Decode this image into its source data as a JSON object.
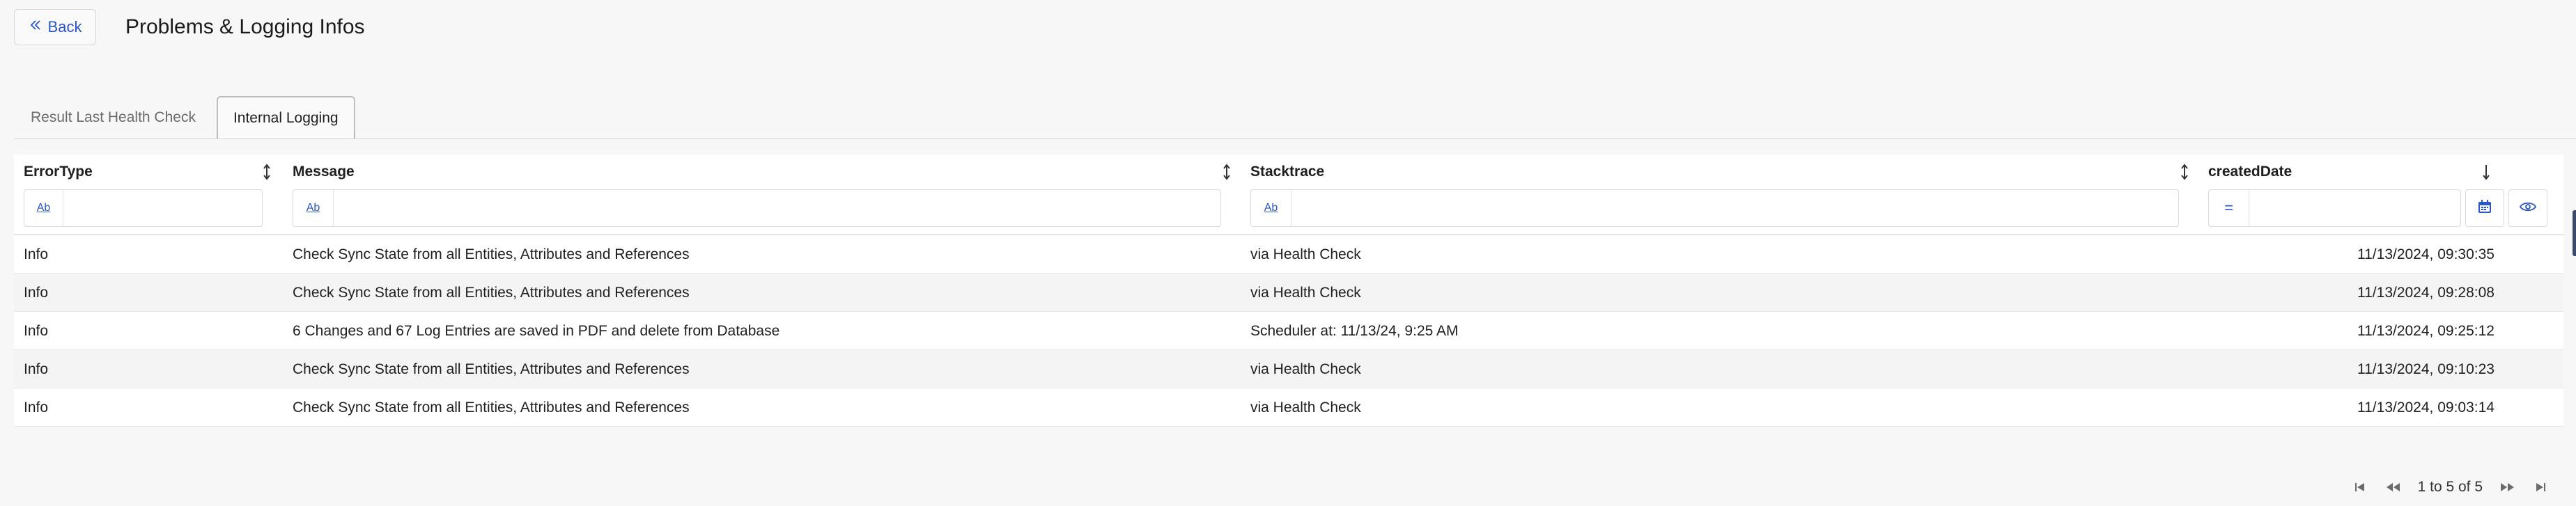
{
  "header": {
    "back_label": "Back",
    "title": "Problems & Logging Infos"
  },
  "tabs": [
    {
      "label": "Result Last Health Check",
      "active": false
    },
    {
      "label": "Internal Logging",
      "active": true
    }
  ],
  "table": {
    "columns": [
      {
        "label": "ErrorType",
        "sort": "unsorted",
        "filter_type": "Ab"
      },
      {
        "label": "Message",
        "sort": "unsorted",
        "filter_type": "Ab"
      },
      {
        "label": "Stacktrace",
        "sort": "unsorted",
        "filter_type": "Ab"
      },
      {
        "label": "createdDate",
        "sort": "descending",
        "filter_type": "="
      }
    ],
    "rows": [
      {
        "errortype": "Info",
        "message": "Check Sync State from all Entities, Attributes and References",
        "stacktrace": "via Health Check",
        "created": "11/13/2024, 09:30:35"
      },
      {
        "errortype": "Info",
        "message": "Check Sync State from all Entities, Attributes and References",
        "stacktrace": "via Health Check",
        "created": "11/13/2024, 09:28:08"
      },
      {
        "errortype": "Info",
        "message": "6 Changes and 67 Log Entries are saved in PDF and delete from Database",
        "stacktrace": "Scheduler at: 11/13/24, 9:25 AM",
        "created": "11/13/2024, 09:25:12"
      },
      {
        "errortype": "Info",
        "message": "Check Sync State from all Entities, Attributes and References",
        "stacktrace": "via Health Check",
        "created": "11/13/2024, 09:10:23"
      },
      {
        "errortype": "Info",
        "message": "Check Sync State from all Entities, Attributes and References",
        "stacktrace": "via Health Check",
        "created": "11/13/2024, 09:03:14"
      }
    ]
  },
  "pagination": {
    "text": "1 to 5 of 5"
  },
  "icons": {
    "back": "double-chevron-left-icon",
    "sort_unsorted": "sort-arrows-icon",
    "sort_desc": "arrow-down-icon",
    "calendar": "calendar-icon",
    "eye": "eye-icon",
    "first": "first-page-icon",
    "prev": "previous-page-icon",
    "next": "next-page-icon",
    "last": "last-page-icon"
  },
  "colors": {
    "accent": "#2a56c6",
    "background": "#f7f7f7"
  }
}
